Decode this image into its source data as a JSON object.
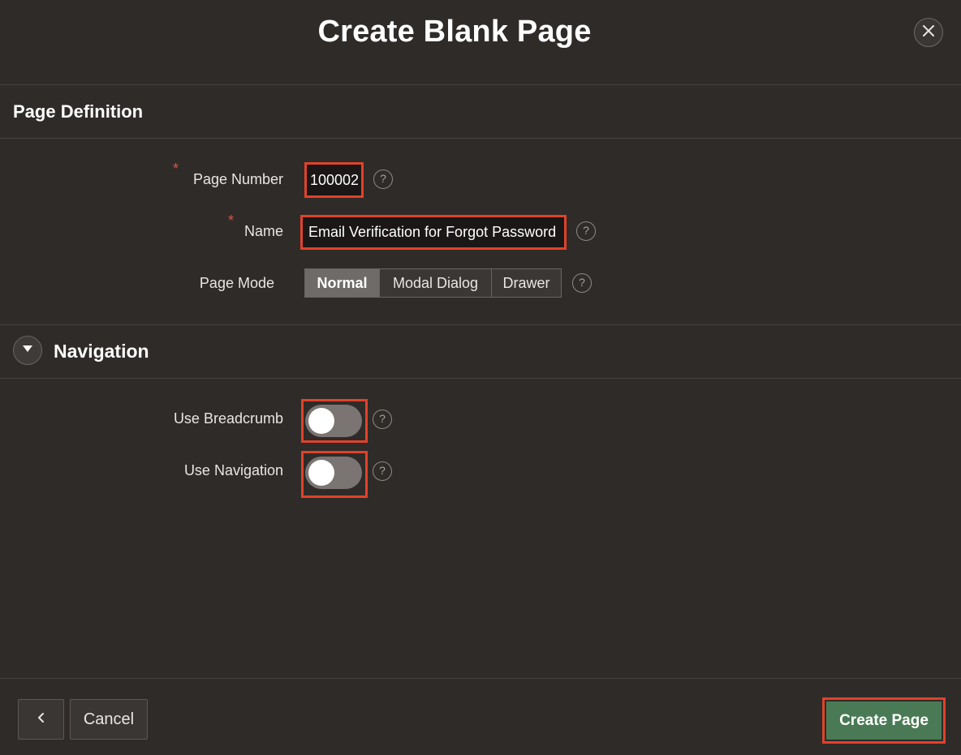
{
  "dialog": {
    "title": "Create Blank Page",
    "close_icon": "close-icon"
  },
  "page_definition": {
    "section_title": "Page Definition",
    "page_number_label": "Page Number",
    "page_number_value": "100002",
    "name_label": "Name",
    "name_value": "Email Verification for Forgot Password",
    "required_marker": "*",
    "page_mode_label": "Page Mode",
    "page_mode_options": [
      "Normal",
      "Modal Dialog",
      "Drawer"
    ],
    "page_mode_selected": "Normal",
    "help_glyph": "?"
  },
  "navigation": {
    "section_title": "Navigation",
    "collapse_icon": "chevron-down-icon",
    "use_breadcrumb_label": "Use Breadcrumb",
    "use_breadcrumb_on": false,
    "use_navigation_label": "Use Navigation",
    "use_navigation_on": false
  },
  "footer": {
    "back_icon": "chevron-left-icon",
    "cancel_label": "Cancel",
    "create_label": "Create Page"
  },
  "colors": {
    "background": "#2f2b29",
    "highlight": "#e0422a",
    "primary_button": "#4a7a55",
    "required": "#e0533a"
  }
}
